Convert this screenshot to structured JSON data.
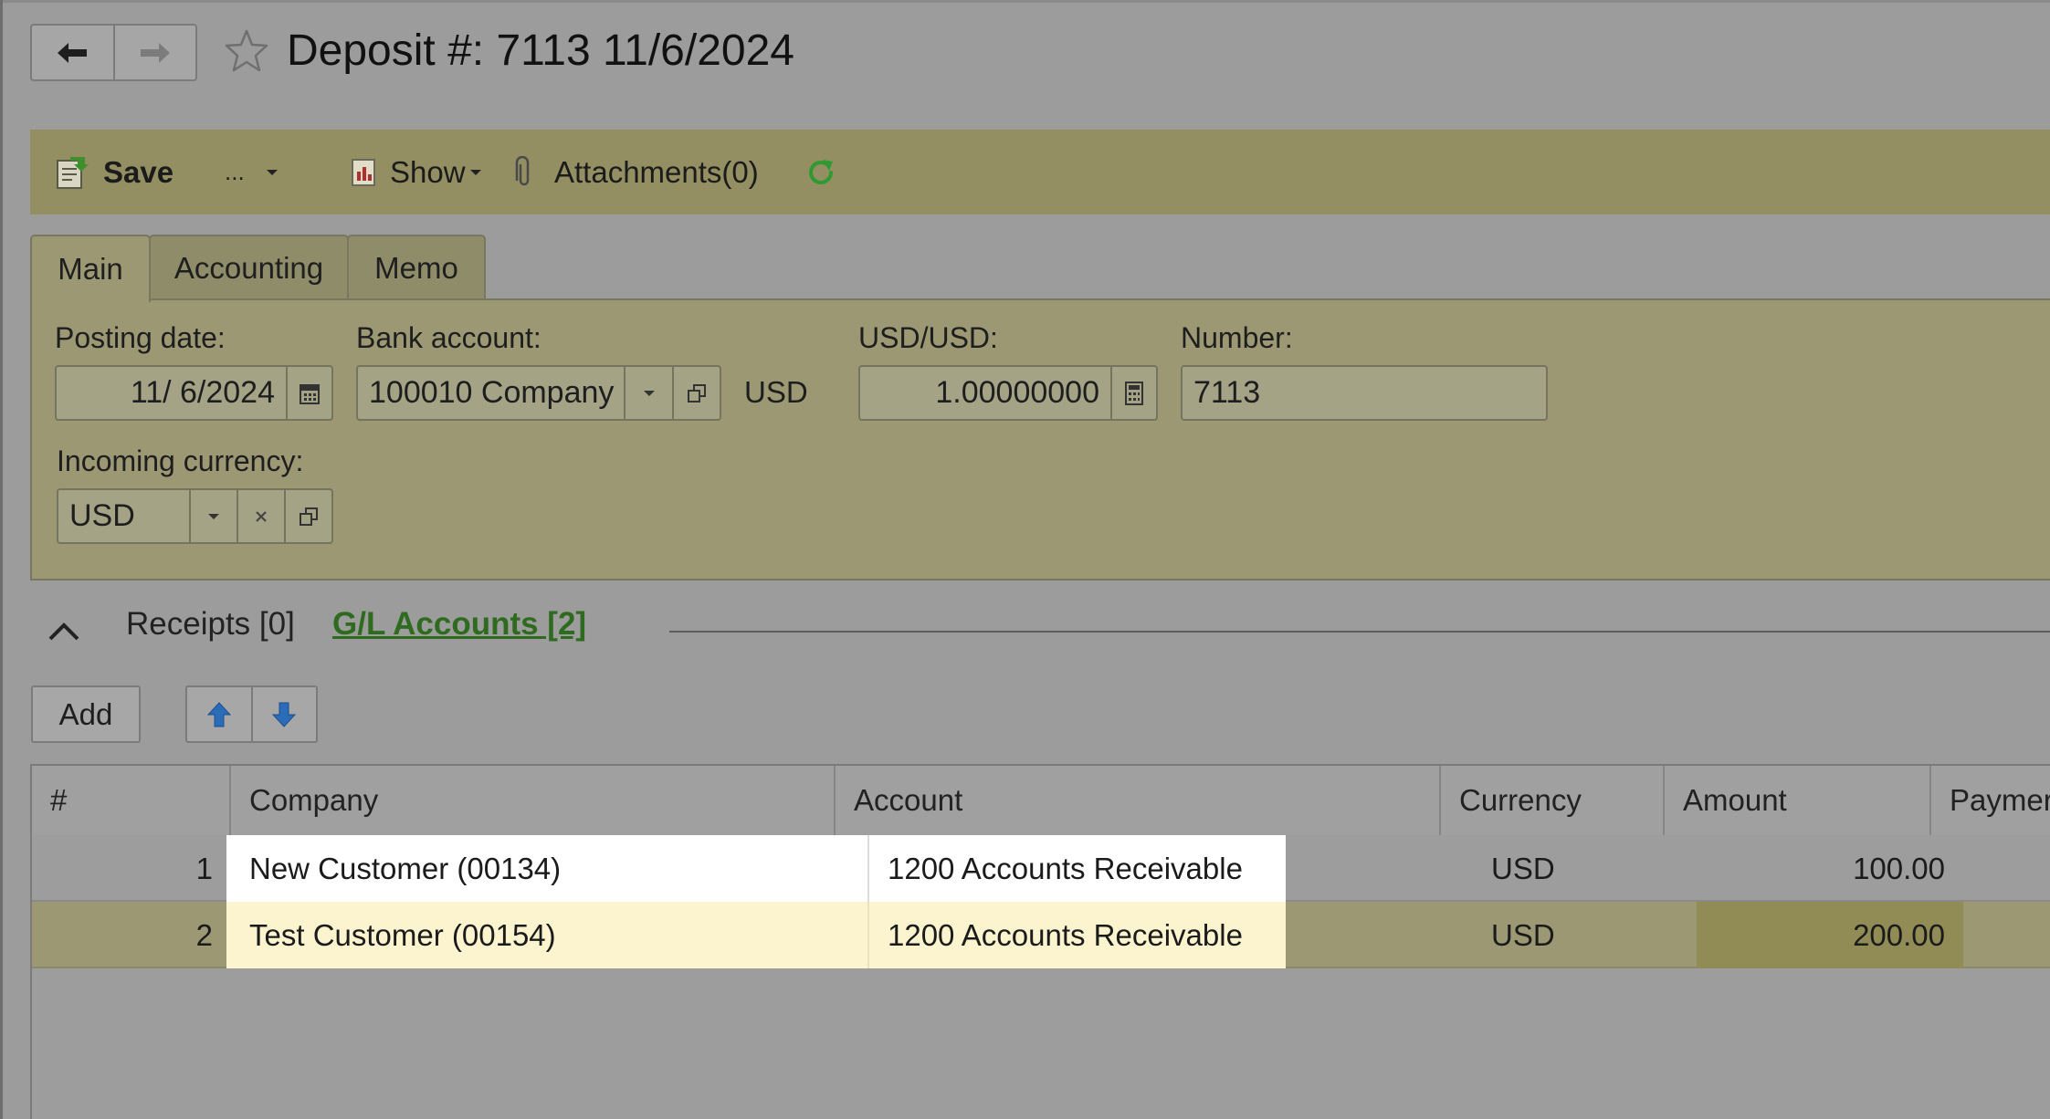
{
  "header": {
    "title": "Deposit #: 7113 11/6/2024"
  },
  "toolbar": {
    "save_label": "Save",
    "more_label": "...",
    "show_label": "Show",
    "attachments_label": "Attachments(0)"
  },
  "tabs": [
    {
      "label": "Main",
      "active": true
    },
    {
      "label": "Accounting",
      "active": false
    },
    {
      "label": "Memo",
      "active": false
    }
  ],
  "form": {
    "posting_date_label": "Posting date:",
    "posting_date_value": "11/ 6/2024",
    "bank_account_label": "Bank account:",
    "bank_account_value": "100010 Company",
    "bank_currency": "USD",
    "rate_label": "USD/USD:",
    "rate_value": "1.00000000",
    "number_label": "Number:",
    "number_value": "7113",
    "incoming_currency_label": "Incoming currency:",
    "incoming_currency_value": "USD"
  },
  "section": {
    "receipts_label": "Receipts [0]",
    "gl_accounts_label": "G/L Accounts [2]"
  },
  "grid_toolbar": {
    "add_label": "Add"
  },
  "table": {
    "columns": [
      "#",
      "Company",
      "Account",
      "Currency",
      "Amount",
      "Paymer"
    ],
    "rows": [
      {
        "num": "1",
        "company": "New Customer (00134)",
        "account": "1200 Accounts Receivable",
        "currency": "USD",
        "amount": "100.00"
      },
      {
        "num": "2",
        "company": "Test Customer (00154)",
        "account": "1200 Accounts Receivable",
        "currency": "USD",
        "amount": "200.00"
      }
    ]
  },
  "colors": {
    "toolbar_bg": "#938f62",
    "panel_bg": "#9b9873",
    "link_green": "#2e6b1f",
    "refresh_green": "#2f9a2f",
    "arrow_blue": "#2b6cb8"
  }
}
